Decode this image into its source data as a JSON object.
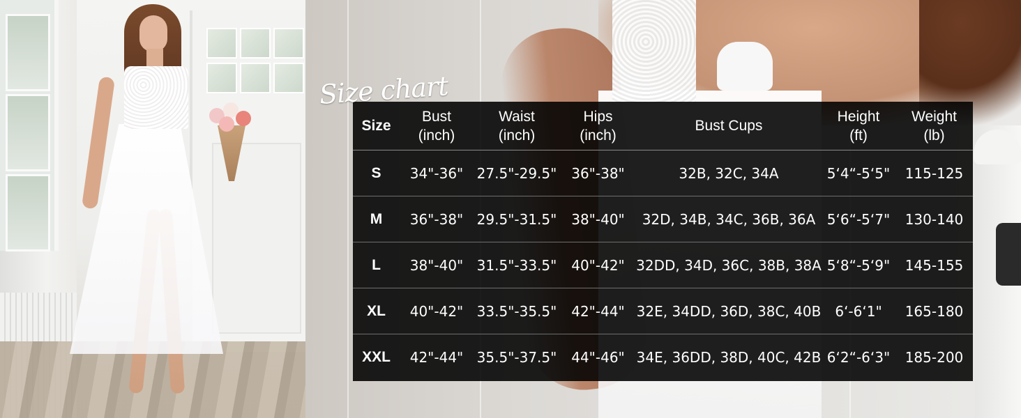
{
  "chart_title": "Size chart",
  "table": {
    "headers": [
      {
        "line1": "Size",
        "line2": ""
      },
      {
        "line1": "Bust",
        "line2": "(inch)"
      },
      {
        "line1": "Waist",
        "line2": "(inch)"
      },
      {
        "line1": "Hips",
        "line2": "(inch)"
      },
      {
        "line1": "Bust Cups",
        "line2": ""
      },
      {
        "line1": "Height",
        "line2": "(ft)"
      },
      {
        "line1": "Weight",
        "line2": "(lb)"
      }
    ],
    "rows": [
      {
        "size": "S",
        "bust": "34\"-36\"",
        "waist": "27.5\"-29.5\"",
        "hips": "36\"-38\"",
        "cups": "32B, 32C, 34A",
        "height": "5‘4“-5‘5\"",
        "weight": "115-125"
      },
      {
        "size": "M",
        "bust": "36\"-38\"",
        "waist": "29.5\"-31.5\"",
        "hips": "38\"-40\"",
        "cups": "32D, 34B, 34C, 36B, 36A",
        "height": "5‘6“-5‘7\"",
        "weight": "130-140"
      },
      {
        "size": "L",
        "bust": "38\"-40\"",
        "waist": "31.5\"-33.5\"",
        "hips": "40\"-42\"",
        "cups": "32DD, 34D, 36C, 38B, 38A",
        "height": "5‘8“-5‘9\"",
        "weight": "145-155"
      },
      {
        "size": "XL",
        "bust": "40\"-42\"",
        "waist": "33.5\"-35.5\"",
        "hips": "42\"-44\"",
        "cups": "32E, 34DD, 36D, 38C, 40B",
        "height": "6‘-6‘1\"",
        "weight": "165-180"
      },
      {
        "size": "XXL",
        "bust": "42\"-44\"",
        "waist": "35.5\"-37.5\"",
        "hips": "44\"-46\"",
        "cups": "34E, 36DD, 38D, 40C, 42B",
        "height": "6‘2“-6‘3\"",
        "weight": "185-200"
      }
    ]
  },
  "colors": {
    "table_background": "#000000",
    "table_text": "#ffffff",
    "title_text": "#ffffff"
  }
}
